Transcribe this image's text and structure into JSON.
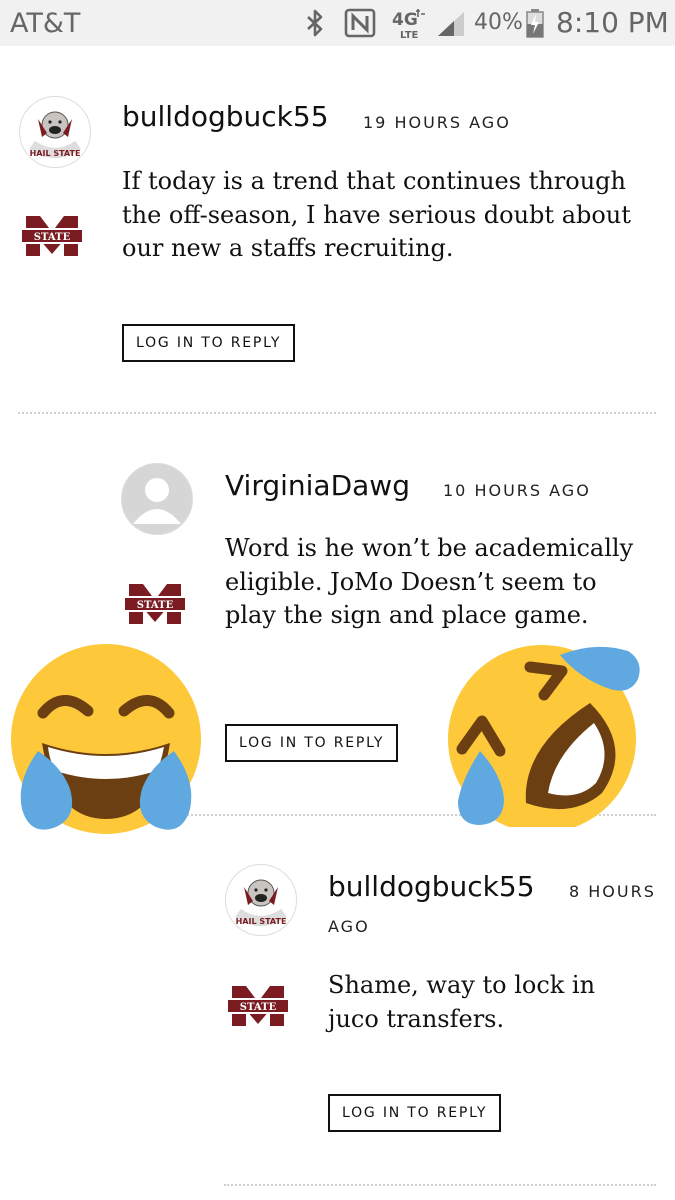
{
  "status_bar": {
    "carrier": "AT&T",
    "battery_percent": "40%",
    "time": "8:10 PM",
    "icons": [
      "bluetooth-icon",
      "nfc-icon",
      "4g-lte-icon",
      "signal-icon",
      "battery-icon"
    ]
  },
  "comments": [
    {
      "username": "bulldogbuck55",
      "timestamp": "19 HOURS AGO",
      "text": "If today is a trend that continues through the off-season, I have serious doubt about our new a staffs recruiting.",
      "reply_label": "LOG IN TO REPLY",
      "avatar": "bulldog-avatar",
      "avatar_text": "HAIL STATE"
    },
    {
      "username": "VirginiaDawg",
      "timestamp": "10 HOURS AGO",
      "text": "Word is he won’t be academically eligible. JoMo Doesn’t seem to play the sign and place game.",
      "reply_label": "LOG IN TO REPLY",
      "avatar": "default-user-avatar"
    },
    {
      "username": "bulldogbuck55",
      "timestamp_line1": "8 HOURS",
      "timestamp_line2": "AGO",
      "text": "Shame, way to lock in juco transfers.",
      "reply_label": "LOG IN TO REPLY",
      "avatar": "bulldog-avatar",
      "avatar_text": "HAIL STATE"
    }
  ],
  "team_logo_text": "STATE",
  "colors": {
    "maroon": "#7a1c22",
    "emoji_yellow": "#fdc93b",
    "tear_blue": "#5fa8e0",
    "mouth_brown": "#6b3f12"
  },
  "overlays": [
    "tears-of-joy-emoji",
    "rolling-on-floor-laughing-emoji"
  ]
}
